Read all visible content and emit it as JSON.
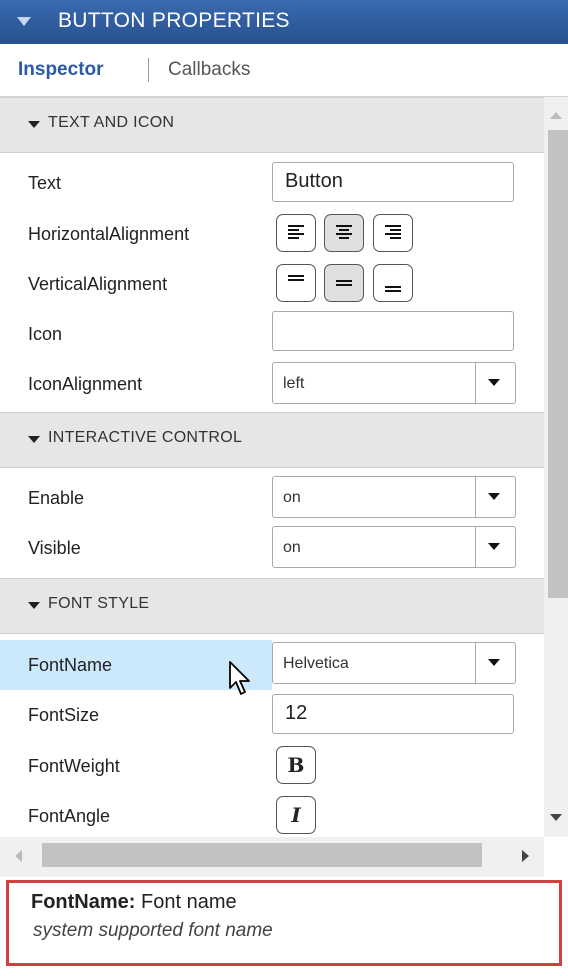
{
  "title": "BUTTON PROPERTIES",
  "tabs": {
    "inspector": "Inspector",
    "callbacks": "Callbacks"
  },
  "sections": {
    "text_icon": "TEXT AND ICON",
    "interactive": "INTERACTIVE CONTROL",
    "font_style": "FONT STYLE"
  },
  "props": {
    "text": {
      "label": "Text",
      "value": "Button"
    },
    "halign": {
      "label": "HorizontalAlignment"
    },
    "valign": {
      "label": "VerticalAlignment"
    },
    "icon": {
      "label": "Icon",
      "value": ""
    },
    "iconalign": {
      "label": "IconAlignment",
      "value": "left"
    },
    "enable": {
      "label": "Enable",
      "value": "on"
    },
    "visible": {
      "label": "Visible",
      "value": "on"
    },
    "fontname": {
      "label": "FontName",
      "value": "Helvetica"
    },
    "fontsize": {
      "label": "FontSize",
      "value": "12"
    },
    "fontweight": {
      "label": "FontWeight",
      "glyph": "B"
    },
    "fontangle": {
      "label": "FontAngle",
      "glyph": "I"
    }
  },
  "description": {
    "name": "FontName:",
    "short": "Font name",
    "detail": "system supported font name"
  },
  "colors": {
    "titlebar": "#2b5797",
    "active_tab": "#2c5aa7",
    "highlight_row": "#cce8fb",
    "desc_border": "#d04040"
  }
}
